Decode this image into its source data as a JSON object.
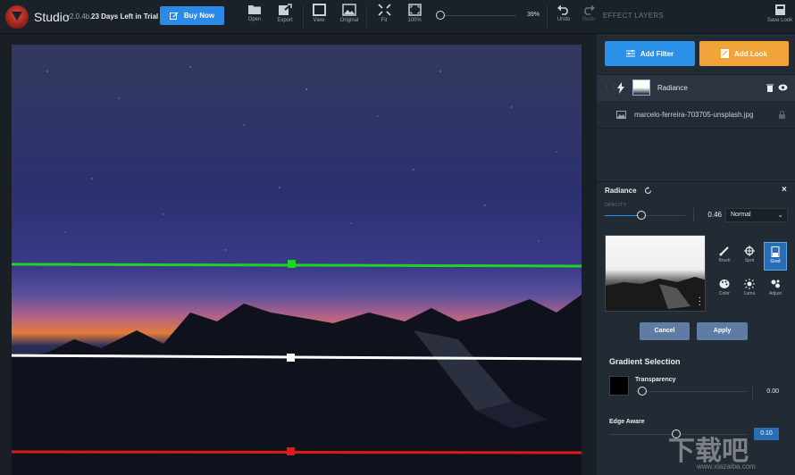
{
  "app": {
    "title": "Studio",
    "version": "v2.0.4b,",
    "trial": "23 Days Left in Trial",
    "buy_label": "Buy Now"
  },
  "toolbar": {
    "open": "Open",
    "export": "Export",
    "view": "View",
    "original": "Original",
    "fit": "Fit",
    "zoom100": "100%",
    "zoom_value": "39%",
    "undo": "Undo",
    "redo": "Redo",
    "save_look": "Save Look"
  },
  "panel": {
    "header": "EFFECT LAYERS",
    "add_filter": "Add Filter",
    "add_look": "Add Look",
    "layer": {
      "name": "Radiance"
    },
    "photo": {
      "name": "marcelo-ferreira-703705-unsplash.jpg"
    },
    "filter": {
      "title": "Radiance",
      "opacity_label": "OPACITY",
      "opacity_value": "0.46",
      "opacity_fraction": 0.46,
      "blend_mode": "Normal",
      "tools": [
        "Brush",
        "Spot",
        "Grad",
        "Color",
        "Luma",
        "Adjust"
      ],
      "active_tool": "Grad",
      "cancel": "Cancel",
      "apply": "Apply"
    },
    "gradient": {
      "title": "Gradient Selection",
      "transparency_label": "Transparency",
      "transparency_value": "0.00",
      "edge_aware_label": "Edge Aware",
      "edge_aware_value": "0.10"
    }
  },
  "watermark": {
    "big": "下载吧",
    "small": "www.xiazaiba.com"
  },
  "colors": {
    "accent_blue": "#2a90e8",
    "accent_orange": "#f0a43a",
    "gradient_green": "#1fd31f",
    "gradient_white": "#ffffff",
    "gradient_red": "#e01818"
  }
}
